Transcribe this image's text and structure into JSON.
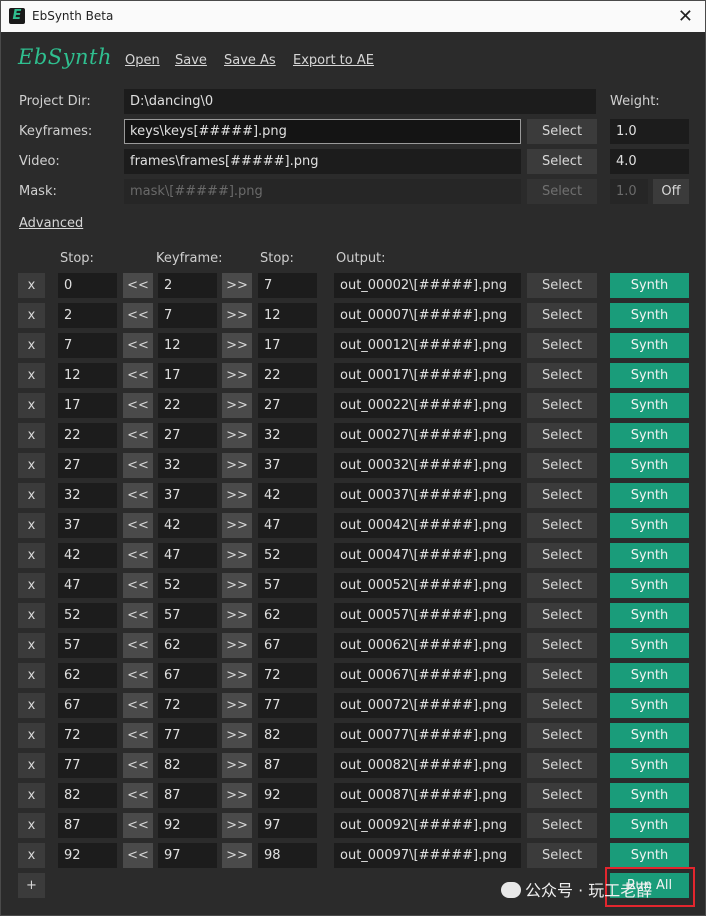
{
  "window": {
    "title": "EbSynth Beta",
    "app_icon": "E",
    "close_glyph": "✕"
  },
  "logo": "EbSynth",
  "menu": {
    "open": "Open",
    "save": "Save",
    "save_as": "Save As",
    "export": "Export to AE"
  },
  "labels": {
    "project_dir": "Project Dir:",
    "keyframes": "Keyframes:",
    "video": "Video:",
    "mask": "Mask:",
    "weight": "Weight:"
  },
  "fields": {
    "project_dir": "D:\\dancing\\0",
    "keyframes": "keys\\keys[#####].png",
    "video": "frames\\frames[#####].png",
    "mask": "mask\\[#####].png"
  },
  "weights": {
    "keyframes": "1.0",
    "video": "4.0",
    "mask": "1.0"
  },
  "buttons": {
    "select": "Select",
    "off": "Off",
    "synth": "Synth",
    "remove": "x",
    "prev": "<<",
    "next": ">>",
    "add": "+",
    "run_all": "Run All"
  },
  "advanced": "Advanced",
  "headers": {
    "stop_left": "Stop:",
    "keyframe": "Keyframe:",
    "stop_right": "Stop:",
    "output": "Output:"
  },
  "rows": [
    {
      "stop1": "0",
      "key": "2",
      "stop2": "7",
      "output": "out_00002\\[#####].png"
    },
    {
      "stop1": "2",
      "key": "7",
      "stop2": "12",
      "output": "out_00007\\[#####].png"
    },
    {
      "stop1": "7",
      "key": "12",
      "stop2": "17",
      "output": "out_00012\\[#####].png"
    },
    {
      "stop1": "12",
      "key": "17",
      "stop2": "22",
      "output": "out_00017\\[#####].png"
    },
    {
      "stop1": "17",
      "key": "22",
      "stop2": "27",
      "output": "out_00022\\[#####].png"
    },
    {
      "stop1": "22",
      "key": "27",
      "stop2": "32",
      "output": "out_00027\\[#####].png"
    },
    {
      "stop1": "27",
      "key": "32",
      "stop2": "37",
      "output": "out_00032\\[#####].png"
    },
    {
      "stop1": "32",
      "key": "37",
      "stop2": "42",
      "output": "out_00037\\[#####].png"
    },
    {
      "stop1": "37",
      "key": "42",
      "stop2": "47",
      "output": "out_00042\\[#####].png"
    },
    {
      "stop1": "42",
      "key": "47",
      "stop2": "52",
      "output": "out_00047\\[#####].png"
    },
    {
      "stop1": "47",
      "key": "52",
      "stop2": "57",
      "output": "out_00052\\[#####].png"
    },
    {
      "stop1": "52",
      "key": "57",
      "stop2": "62",
      "output": "out_00057\\[#####].png"
    },
    {
      "stop1": "57",
      "key": "62",
      "stop2": "67",
      "output": "out_00062\\[#####].png"
    },
    {
      "stop1": "62",
      "key": "67",
      "stop2": "72",
      "output": "out_00067\\[#####].png"
    },
    {
      "stop1": "67",
      "key": "72",
      "stop2": "77",
      "output": "out_00072\\[#####].png"
    },
    {
      "stop1": "72",
      "key": "77",
      "stop2": "82",
      "output": "out_00077\\[#####].png"
    },
    {
      "stop1": "77",
      "key": "82",
      "stop2": "87",
      "output": "out_00082\\[#####].png"
    },
    {
      "stop1": "82",
      "key": "87",
      "stop2": "92",
      "output": "out_00087\\[#####].png"
    },
    {
      "stop1": "87",
      "key": "92",
      "stop2": "97",
      "output": "out_00092\\[#####].png"
    },
    {
      "stop1": "92",
      "key": "97",
      "stop2": "98",
      "output": "out_00097\\[#####].png"
    }
  ],
  "watermark": "公众号 · 玩工老薛",
  "colors": {
    "accent": "#1a9c7a",
    "highlight": "#e3262e",
    "background": "#2b2b2b"
  }
}
